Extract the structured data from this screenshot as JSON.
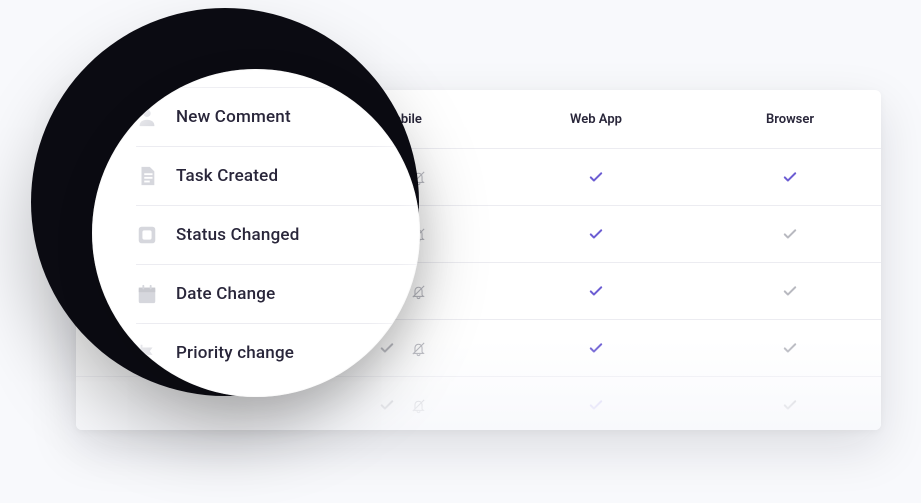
{
  "headers": {
    "mobile": "Mobile",
    "webapp": "Web App",
    "browser": "Browser"
  },
  "options": [
    {
      "key": "new-comment",
      "label": "New Comment",
      "icon": "person"
    },
    {
      "key": "task-created",
      "label": "Task Created",
      "icon": "file"
    },
    {
      "key": "status-changed",
      "label": "Status Changed",
      "icon": "square"
    },
    {
      "key": "date-change",
      "label": "Date Change",
      "icon": "calendar"
    },
    {
      "key": "priority-change",
      "label": "Priority change",
      "icon": "flag"
    }
  ],
  "rows": [
    {
      "mobile_push": "on",
      "mobile_sound": "muted",
      "webapp": "on",
      "browser": "on"
    },
    {
      "mobile_push": "off",
      "mobile_sound": "muted",
      "webapp": "on",
      "browser": "off"
    },
    {
      "mobile_push": "off",
      "mobile_sound": "muted",
      "webapp": "on",
      "browser": "off"
    },
    {
      "mobile_push": "off",
      "mobile_sound": "muted",
      "webapp": "on",
      "browser": "off"
    },
    {
      "mobile_push": "off",
      "mobile_sound": "muted",
      "webapp": "dim",
      "browser": "off"
    }
  ],
  "colors": {
    "accent": "#6c5dd3",
    "muted": "#b8b9c0",
    "accent_dim": "#c6bff3"
  }
}
